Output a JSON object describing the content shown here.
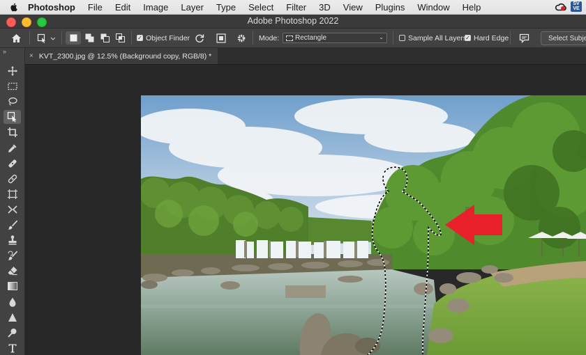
{
  "menubar": {
    "app_name": "Photoshop",
    "items": [
      "File",
      "Edit",
      "Image",
      "Layer",
      "Type",
      "Select",
      "Filter",
      "3D",
      "View",
      "Plugins",
      "Window",
      "Help"
    ],
    "tray_badge": "SV\nVE"
  },
  "window": {
    "title": "Adobe Photoshop 2022"
  },
  "options_bar": {
    "object_finder_label": "Object Finder",
    "object_finder_checked": true,
    "mode_label": "Mode:",
    "mode_value": "Rectangle",
    "sample_all_layers_label": "Sample All Layers",
    "sample_all_layers_checked": false,
    "hard_edge_label": "Hard Edge",
    "hard_edge_checked": true,
    "select_subject_label": "Select Subject"
  },
  "toolbar": {
    "collapse_glyph": "»",
    "tools": [
      "move-tool",
      "marquee-tool",
      "lasso-tool",
      "object-selection-tool",
      "crop-tool",
      "eyedropper-tool",
      "healing-brush-tool",
      "bandage-tool",
      "frame-tool",
      "content-aware-move-tool",
      "brush-tool",
      "clone-stamp-tool",
      "history-brush-tool",
      "eraser-tool",
      "gradient-tool",
      "blur-tool",
      "pen-tool",
      "dodge-tool",
      "type-tool"
    ],
    "active_tool": "object-selection-tool"
  },
  "document_tab": {
    "close_glyph": "×",
    "title": "KVT_2300.jpg @ 12.5% (Background copy, RGB/8) *"
  },
  "colors": {
    "accent_arrow": "#e8202a",
    "panel": "#424242",
    "canvas": "#282828"
  }
}
